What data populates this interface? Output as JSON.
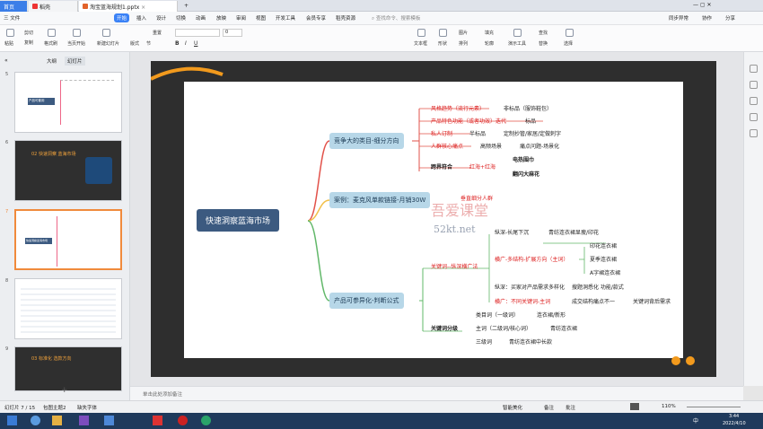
{
  "tabs": {
    "home": "首页",
    "t1": "稻壳",
    "t2": "淘宝蓝海规划1.pptx",
    "plus": "+"
  },
  "window": {
    "login": "⊙",
    "win_ctrls": "—  ▢  ✕"
  },
  "menu": {
    "file": "三 文件",
    "start": "开始",
    "insert": "插入",
    "design": "设计",
    "switch": "切换",
    "anim": "动画",
    "show": "放映",
    "review": "审阅",
    "view": "视图",
    "dev": "开发工具",
    "member": "会员专享",
    "resources": "稻壳资源",
    "search": "查找命令、搜索模板",
    "sync": "同步异常",
    "collab": "协作",
    "share": "分享"
  },
  "ribbon": {
    "paste": "粘贴",
    "cut": "剪切",
    "copy": "复制",
    "fmt": "格式刷",
    "from_start": "当页开始",
    "new_slide": "新建幻灯片",
    "layout": "版式",
    "section": "节",
    "reset": "重置",
    "font": "",
    "size": "0",
    "text_box": "文本框",
    "shape": "形状",
    "arrange": "排列",
    "image": "图片",
    "fill": "填充",
    "outline": "轮廓",
    "find": "查找",
    "replace": "替换",
    "demo": "演示工具",
    "select": "选择"
  },
  "leftpanel": {
    "tab_outline": "大纲",
    "tab_slides": "幻灯片",
    "slides": [
      {
        "num": "5",
        "label": "产品可套用"
      },
      {
        "num": "6",
        "label": "02 快速洞察 蓝海市场"
      },
      {
        "num": "7",
        "label": "快速洞察蓝海市场"
      },
      {
        "num": "8",
        "label": ""
      },
      {
        "num": "9",
        "label": "03 标准化 选款方向"
      }
    ]
  },
  "mindmap": {
    "root": "快速洞察蓝海市场",
    "b1": "竞争大的类目-细分方向",
    "b1_items": [
      {
        "a": "风格趋势（流行元素）",
        "b": "非标品（服饰鞋包）"
      },
      {
        "a": "产品特色功能（或者功效）迭代",
        "b": "标品"
      },
      {
        "a": "私人订制",
        "b": "半标品",
        "c": "定制抄管/家居/定做刺字"
      },
      {
        "a": "人群核心痛点",
        "b": "高频场景",
        "c": "痛点问题-场景化"
      },
      {
        "a": "跨界符合",
        "b": "红海+红海",
        "c": "电热围巾",
        "d": "翻闪大麻花"
      }
    ],
    "b2": "案例：麦克风单款链接-月销30W",
    "b2_sub": "垂直细分人群",
    "watermark": "吾爱课堂",
    "watermark2": "52kt.net",
    "b3": "产品可参异化-判断公式",
    "b3_a": "关键词--纵深横广法",
    "b3_a_items": [
      "纵深-长尾下沉",
      "青纺连衣裙显瘦/印花",
      "横广-多结构-扩展方向（主词）",
      "印花连衣裙",
      "夏季连衣裙",
      "A字裙连衣裙",
      "纵深：买家对产品需求多样化",
      "搜题洞悉化 功能/款式",
      "横广：不同关键词-主词",
      "成交结构痛点不一",
      "关键词背后需求"
    ],
    "b3_b": "关键词分级",
    "b3_b_items": [
      "类目词（一级词）",
      "连衣裙/新形",
      "主词（二级词/核心词）",
      "青纺连衣裙",
      "三级词",
      "青纺连衣裙中长款"
    ]
  },
  "notes": "单击此处添加备注",
  "status": {
    "slide": "幻灯片 7 / 15",
    "theme": "包图主题2",
    "font_missing": "缺失字体",
    "smart": "智能美化",
    "notes": "备注",
    "comment": "批注",
    "zoom": "110%"
  },
  "taskbar": {
    "time": "3:44",
    "date": "2022/4/10",
    "input": "中",
    "ime": "拼"
  }
}
